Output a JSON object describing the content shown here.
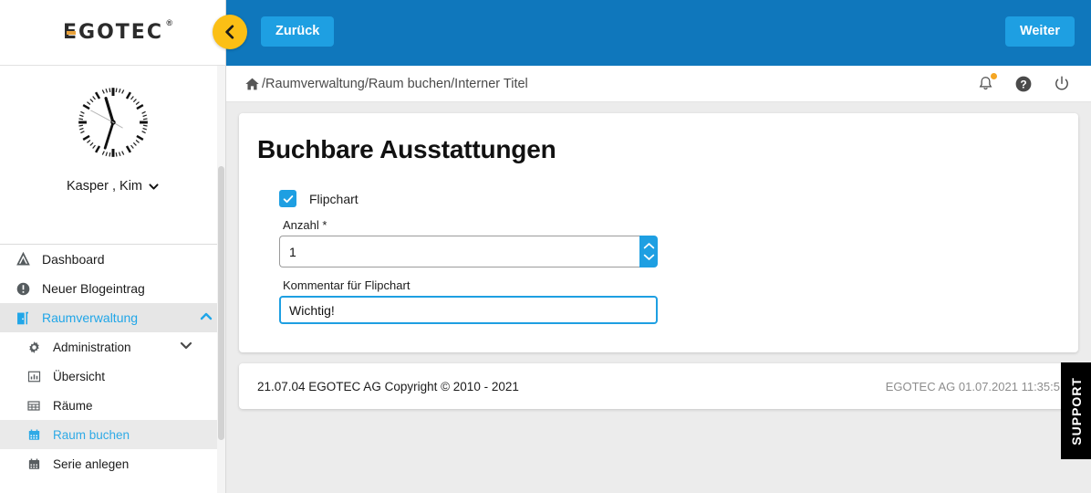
{
  "brand": {
    "logo_text": "EGOTEC",
    "logo_registered": "®",
    "accent_orange": "#e8a13a",
    "header_blue": "#0f77bc",
    "button_blue": "#1e9fe2",
    "back_yellow": "#fbbf15"
  },
  "topbar": {
    "back_circle_icon": "chevron-left-icon",
    "back_label": "Zurück",
    "next_label": "Weiter"
  },
  "breadcrumb": {
    "home_icon": "home-icon",
    "path": "/Raumverwaltung/Raum buchen/Interner Titel",
    "icons": [
      {
        "name": "bell-icon",
        "has_badge": true
      },
      {
        "name": "help-icon",
        "has_badge": false
      },
      {
        "name": "power-icon",
        "has_badge": false
      }
    ]
  },
  "profile": {
    "avatar_icon": "analog-clock-avatar",
    "clock_time": "11:35",
    "name": "Kasper , Kim",
    "chevron_icon": "chevron-down-icon"
  },
  "sidebar": {
    "items": [
      {
        "label": "Dashboard",
        "icon": "dashboard-icon",
        "level": 0,
        "active": false,
        "caret": ""
      },
      {
        "label": "Neuer Blogeintrag",
        "icon": "exclamation-circle-icon",
        "level": 0,
        "active": false,
        "caret": ""
      },
      {
        "label": "Raumverwaltung",
        "icon": "door-icon",
        "level": 0,
        "active": true,
        "caret": "chevron-up-icon"
      },
      {
        "label": "Administration",
        "icon": "gear-icon",
        "level": 1,
        "active": false,
        "caret": "chevron-down-icon"
      },
      {
        "label": "Übersicht",
        "icon": "chart-bars-icon",
        "level": 1,
        "active": false,
        "caret": ""
      },
      {
        "label": "Räume",
        "icon": "table-grid-icon",
        "level": 1,
        "active": false,
        "caret": ""
      },
      {
        "label": "Raum buchen",
        "icon": "calendar-icon",
        "level": 1,
        "active": true,
        "caret": ""
      },
      {
        "label": "Serie anlegen",
        "icon": "calendar-icon",
        "level": 1,
        "active": false,
        "caret": ""
      }
    ]
  },
  "main": {
    "title": "Buchbare Ausstattungen",
    "checkbox": {
      "label": "Flipchart",
      "checked": true,
      "icon": "check-icon"
    },
    "amount_field": {
      "label": "Anzahl",
      "required_marker": "*",
      "value": "1",
      "placeholder": "",
      "spinner_up_icon": "chevron-up-icon",
      "spinner_down_icon": "chevron-down-icon"
    },
    "comment_field": {
      "label": "Kommentar für Flipchart",
      "value": "Wichtig!",
      "placeholder": ""
    }
  },
  "footer": {
    "left": "21.07.04 EGOTEC AG Copyright © 2010 - 2021",
    "right": "EGOTEC AG  01.07.2021 11:35:5"
  },
  "support": {
    "label": "SUPPORT"
  }
}
